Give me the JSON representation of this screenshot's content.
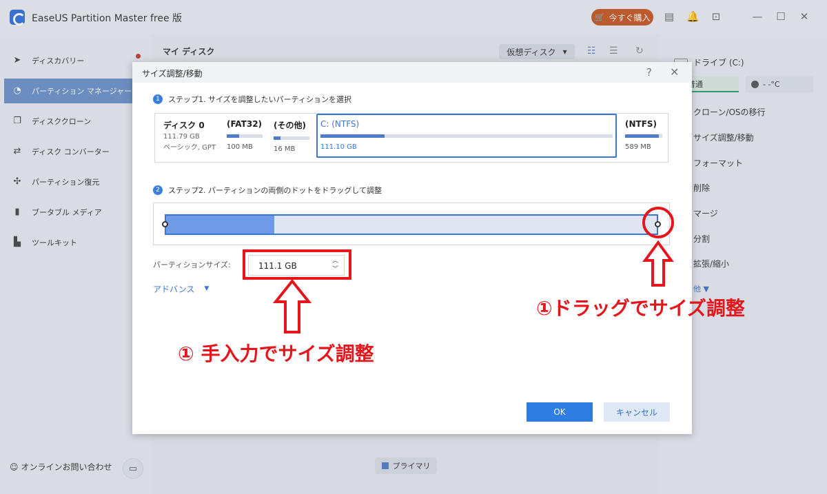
{
  "app": {
    "title": "EaseUS Partition Master free 版",
    "buy_label": "今すぐ購入"
  },
  "sidebar": {
    "items": [
      {
        "label": "ディスカバリー",
        "icon": "compass-icon"
      },
      {
        "label": "パーティション マネージャー",
        "icon": "pie-chart-icon"
      },
      {
        "label": "ディスククローン",
        "icon": "copy-icon"
      },
      {
        "label": "ディスク コンバーター",
        "icon": "convert-icon"
      },
      {
        "label": "パーティション復元",
        "icon": "restore-icon"
      },
      {
        "label": "ブータブル メディア",
        "icon": "usb-icon"
      },
      {
        "label": "ツールキット",
        "icon": "toolkit-icon"
      }
    ],
    "contact_label": "オンラインお問い合わせ"
  },
  "main": {
    "title": "マイ ディスク",
    "vdisk_label": "仮想ディスク",
    "legend_label": "プライマリ"
  },
  "right_panel": {
    "drive_title": "ドライブ (C:)",
    "health_label": "普通",
    "temp_label": "- -°C",
    "operations": [
      "クローン/OSの移行",
      "サイズ調整/移動",
      "フォーマット",
      "削除",
      "マージ",
      "分割",
      "拡張/縮小"
    ],
    "more_label": "他 ▼"
  },
  "dialog": {
    "title": "サイズ調整/移動",
    "step1": {
      "num": "1",
      "label": "ステップ1. サイズを調整したいパーティションを選択"
    },
    "disk": {
      "name": "ディスク 0",
      "size": "111.79 GB",
      "type": "ベーシック, GPT"
    },
    "partitions": [
      {
        "name": "(FAT32)",
        "size": "100 MB",
        "fill": 0.35
      },
      {
        "name": "(その他)",
        "size": "16 MB",
        "fill": 0.2
      },
      {
        "name": "C: (NTFS)",
        "size": "111.10 GB",
        "fill": 0.22
      },
      {
        "name": "(NTFS)",
        "size": "589 MB",
        "fill": 0.9
      }
    ],
    "step2": {
      "num": "2",
      "label": "ステップ2. パーティションの両側のドットをドラッグして調整"
    },
    "size_label": "パーティションサイズ:",
    "size_value": "111.1 GB",
    "used_fraction": 0.22,
    "advanced_label": "アドバンス",
    "ok_label": "OK",
    "cancel_label": "キャンセル"
  },
  "annotations": {
    "manual": "① 手入力でサイズ調整",
    "drag": "①ドラッグでサイズ調整"
  },
  "colors": {
    "accent": "#2f7de1",
    "annotation": "#e4161b",
    "buy": "#c7551f"
  }
}
